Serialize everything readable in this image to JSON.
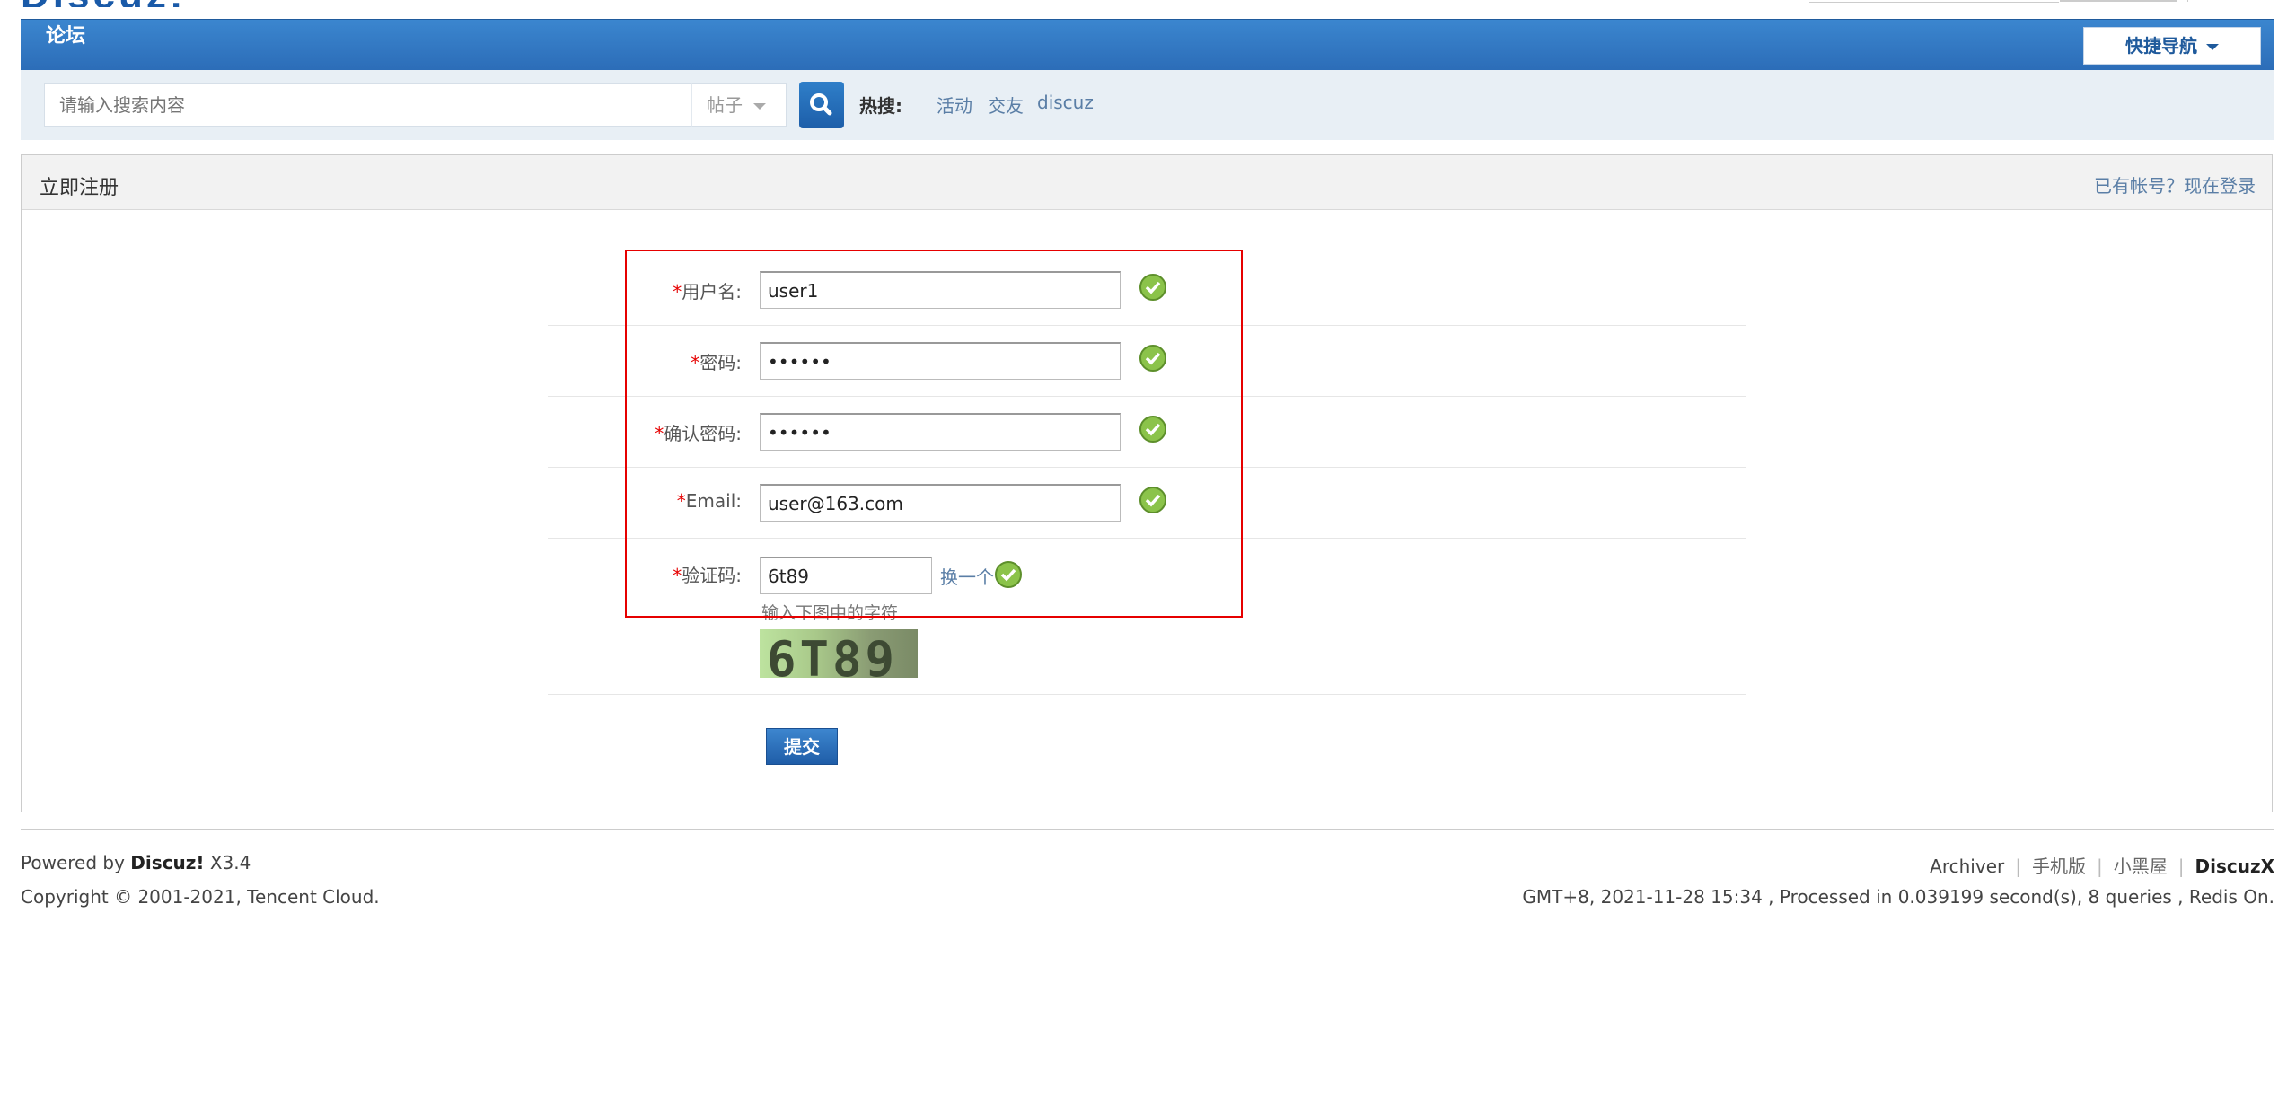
{
  "brand": {
    "logo_text": "Discuz!"
  },
  "nav": {
    "home_label": "论坛",
    "quick_nav_label": "快捷导航"
  },
  "search": {
    "placeholder": "请输入搜索内容",
    "type_label": "帖子",
    "hot_label": "热搜:",
    "hot_links": [
      "活动",
      "交友",
      "discuz"
    ]
  },
  "panel": {
    "title": "立即注册",
    "login_link": "已有帐号？现在登录"
  },
  "form": {
    "fields": [
      {
        "required": "*",
        "label": "用户名:",
        "value": "user1",
        "valid": true
      },
      {
        "required": "*",
        "label": "密码:",
        "value": "••••••",
        "valid": true
      },
      {
        "required": "*",
        "label": "确认密码:",
        "value": "••••••",
        "valid": true
      },
      {
        "required": "*",
        "label": "Email:",
        "value": "user@163.com",
        "valid": true
      },
      {
        "required": "*",
        "label": "验证码:",
        "value": "6t89",
        "valid": true
      }
    ],
    "captcha_refresh_label": "换一个",
    "captcha_hint": "输入下图中的字符",
    "captcha_image_text": "6T89",
    "submit_label": "提交"
  },
  "footer": {
    "powered_prefix": "Powered by ",
    "powered_brand": "Discuz!",
    "powered_version": " X3.4",
    "copyright": "Copyright © 2001-2021, Tencent Cloud.",
    "links": [
      "Archiver",
      "手机版",
      "小黑屋"
    ],
    "brand_link": "DiscuzX",
    "stats": "GMT+8, 2021-11-28 15:34 , Processed in 0.039199 second(s), 8 queries , Redis On."
  },
  "colors": {
    "nav_blue": "#2c6db8",
    "link_blue": "#5a7ea6",
    "required_red": "#e60000",
    "highlight_red": "#e60000",
    "check_green": "#8bc34a"
  }
}
